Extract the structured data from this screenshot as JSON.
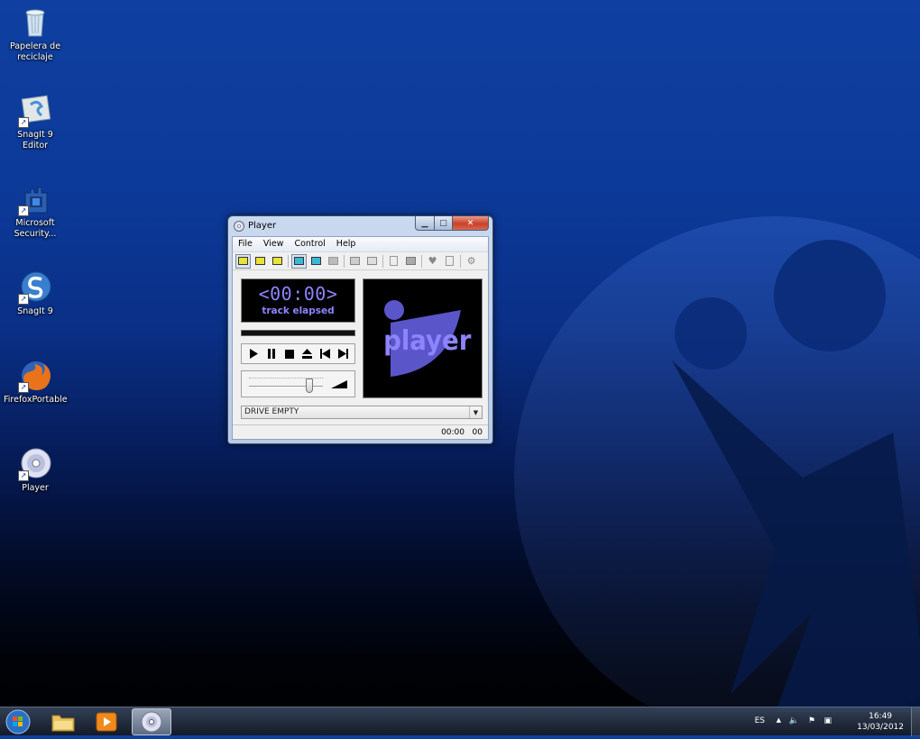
{
  "desktop": {
    "icons": [
      {
        "label": "Papelera de reciclaje"
      },
      {
        "label": "SnagIt 9 Editor"
      },
      {
        "label": "Microsoft Security..."
      },
      {
        "label": "SnagIt 9"
      },
      {
        "label": "FirefoxPortable"
      },
      {
        "label": "Player"
      }
    ]
  },
  "window": {
    "title": "Player",
    "menu": [
      "File",
      "View",
      "Control",
      "Help"
    ],
    "time_value": "<00:00>",
    "time_label": "track elapsed",
    "progress": 0,
    "volume_level": 0.85,
    "logo_text": "player",
    "drive_value": "DRIVE EMPTY",
    "status_time": "00:00",
    "status_track": "00"
  },
  "taskbar": {
    "lang": "ES",
    "clock_time": "16:49",
    "clock_date": "13/03/2012"
  },
  "colors": {
    "accent": "#8d84ff",
    "logo_panel": "#5a55c8"
  }
}
